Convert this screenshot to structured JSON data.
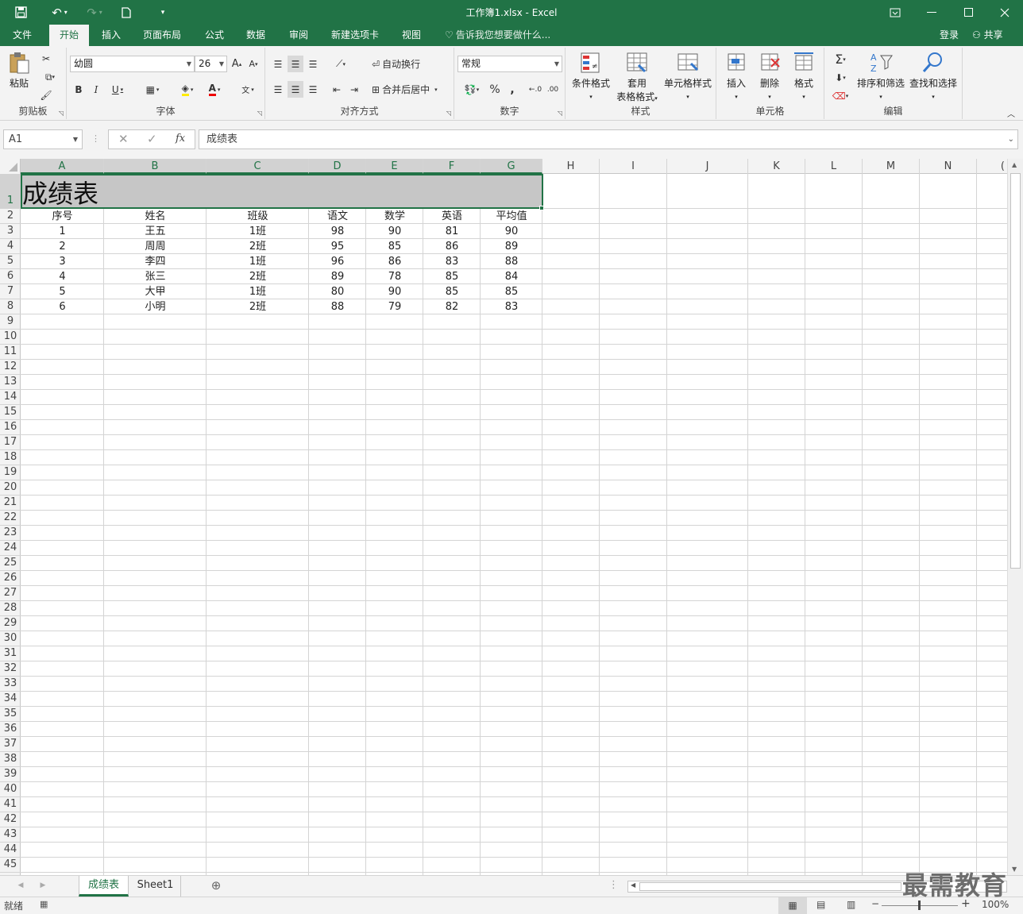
{
  "app": {
    "title": "工作簿1.xlsx - Excel"
  },
  "tabs": [
    {
      "label": "文件",
      "active": false
    },
    {
      "label": "开始",
      "active": true
    },
    {
      "label": "插入",
      "active": false
    },
    {
      "label": "页面布局",
      "active": false
    },
    {
      "label": "公式",
      "active": false
    },
    {
      "label": "数据",
      "active": false
    },
    {
      "label": "审阅",
      "active": false
    },
    {
      "label": "新建选项卡",
      "active": false
    },
    {
      "label": "视图",
      "active": false
    }
  ],
  "tell_me": "告诉我您想要做什么...",
  "account": {
    "login": "登录",
    "share": "共享"
  },
  "ribbon": {
    "clipboard": {
      "label": "剪贴板",
      "paste": "粘贴"
    },
    "font": {
      "label": "字体",
      "name": "幼圆",
      "size": "26",
      "bold": "B",
      "italic": "I",
      "underline": "U"
    },
    "alignment": {
      "label": "对齐方式",
      "wrap": "自动换行",
      "merge": "合并后居中"
    },
    "number": {
      "label": "数字",
      "format": "常规",
      "percent": "%",
      "comma": ","
    },
    "styles": {
      "label": "样式",
      "conditional": "条件格式",
      "table_line1": "套用",
      "table_line2": "表格格式",
      "cell_styles": "单元格样式"
    },
    "cells": {
      "label": "单元格",
      "insert": "插入",
      "delete": "删除",
      "format": "格式"
    },
    "editing": {
      "label": "编辑",
      "sort": "排序和筛选",
      "find": "查找和选择"
    }
  },
  "formula_bar": {
    "name_box": "A1",
    "formula": "成绩表"
  },
  "columns": [
    "A",
    "B",
    "C",
    "D",
    "E",
    "F",
    "G",
    "H",
    "I",
    "J",
    "K",
    "L",
    "M",
    "N"
  ],
  "sheet": {
    "title": "成绩表",
    "headers": [
      "序号",
      "姓名",
      "班级",
      "语文",
      "数学",
      "英语",
      "平均值"
    ],
    "rows": [
      [
        "1",
        "王五",
        "1班",
        "98",
        "90",
        "81",
        "90"
      ],
      [
        "2",
        "周周",
        "2班",
        "95",
        "85",
        "86",
        "89"
      ],
      [
        "3",
        "李四",
        "1班",
        "96",
        "86",
        "83",
        "88"
      ],
      [
        "4",
        "张三",
        "2班",
        "89",
        "78",
        "85",
        "84"
      ],
      [
        "5",
        "大甲",
        "1班",
        "80",
        "90",
        "85",
        "85"
      ],
      [
        "6",
        "小明",
        "2班",
        "88",
        "79",
        "82",
        "83"
      ]
    ]
  },
  "sheet_tabs": [
    {
      "label": "成绩表",
      "active": true
    },
    {
      "label": "Sheet1",
      "active": false
    }
  ],
  "status": {
    "ready": "就绪",
    "zoom": "100%"
  },
  "watermark": "最需教育",
  "colors": {
    "accent": "#217346",
    "selection_fill": "#c6c6c6"
  }
}
